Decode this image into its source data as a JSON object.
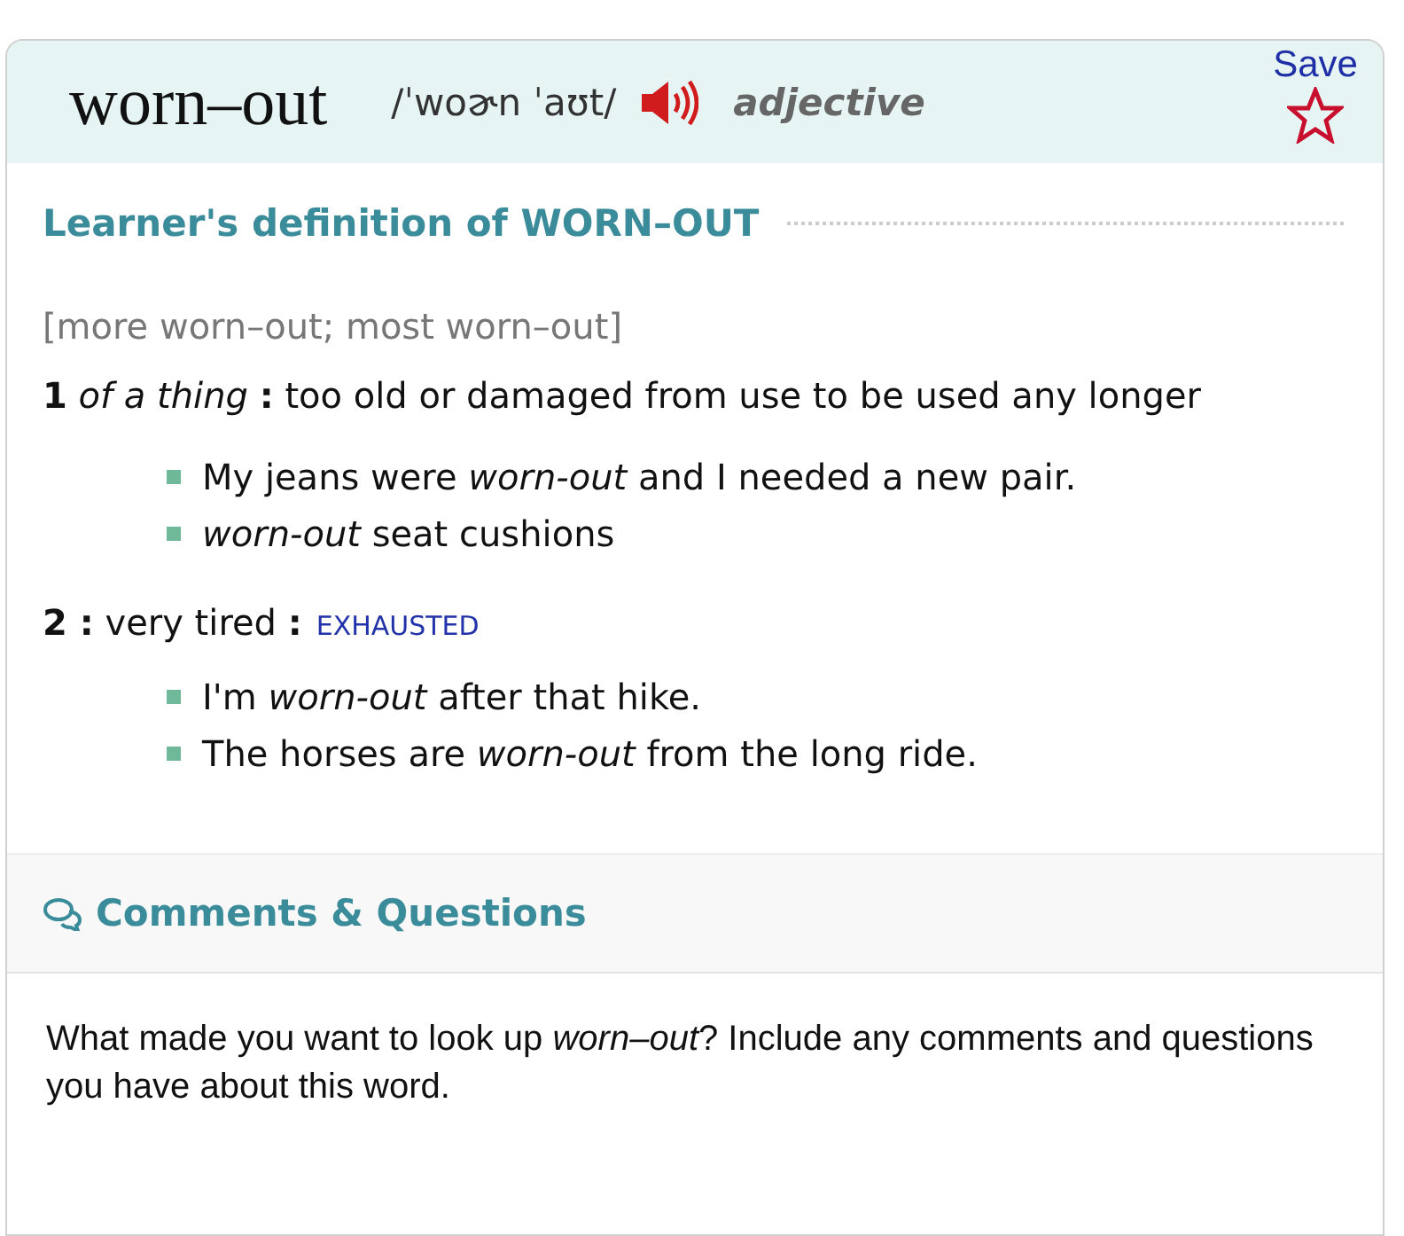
{
  "entry": {
    "headword": "worn–out",
    "pronunciation": "/ˈwoɚn ˈaʊt/",
    "part_of_speech": "adjective",
    "save_label": "Save",
    "saved": false
  },
  "definition": {
    "heading": "Learner's definition of WORN–OUT",
    "forms": "[more worn–out; most worn–out]",
    "senses": [
      {
        "text": "**1** *of a thing* **:** too old or damaged from use to be used any longer",
        "examples": [
          "My jeans were *worn-out* and I needed a new pair.",
          "*worn-out* seat cushions"
        ]
      },
      {
        "text": "**2 :** very tired **:**",
        "synonym": "EXHAUSTED",
        "examples": [
          "I'm *worn-out* after that hike.",
          "The horses are *worn-out* from the long ride."
        ]
      }
    ]
  },
  "comments": {
    "heading": "Comments & Questions",
    "prompt": "What made you want to look up *worn–out*? Include any comments and questions you have about this word."
  }
}
